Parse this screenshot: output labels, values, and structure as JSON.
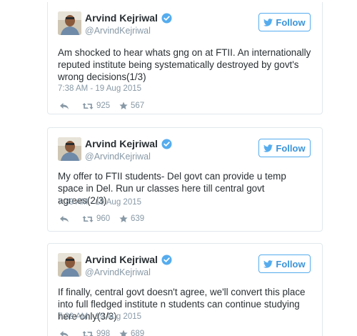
{
  "colors": {
    "twitter_blue": "#55acee",
    "follow_text": "#3b94d9",
    "name_text": "#292f33",
    "meta_text": "#8899a6",
    "border": "#e1e8ed"
  },
  "follow_icon": "twitter-bird-icon",
  "verified_icon": "verified-badge-icon",
  "tweets": [
    {
      "display_name": "Arvind Kejriwal",
      "handle": "@ArvindKejriwal",
      "follow_label": "Follow",
      "text": "Am shocked to hear whats gng on at FTII. An internationally reputed institute being systematically destroyed by govt's wrong decisions(1/3)",
      "timestamp": "7:38 AM - 19 Aug 2015",
      "retweets": "925",
      "favorites": "567"
    },
    {
      "display_name": "Arvind Kejriwal",
      "handle": "@ArvindKejriwal",
      "follow_label": "Follow",
      "text": "My offer to FTII students- Del govt can provide u temp space in Del. Run ur classes here till central govt agrees(2/3)",
      "timestamp": "7:39 AM - 19 Aug 2015",
      "retweets": "960",
      "favorites": "639"
    },
    {
      "display_name": "Arvind Kejriwal",
      "handle": "@ArvindKejriwal",
      "follow_label": "Follow",
      "text": "If finally, central govt doesn't agree, we'll convert this place into full fledged institute n students can continue studying here only(3/3)",
      "timestamp": "7:39 AM - 19 Aug 2015",
      "retweets": "998",
      "favorites": "689"
    }
  ]
}
